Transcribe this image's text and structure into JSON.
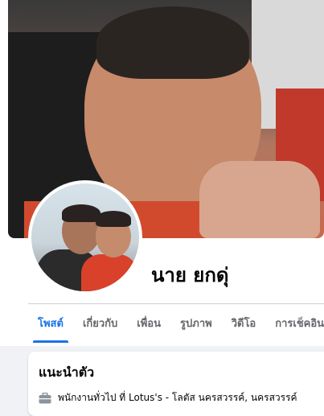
{
  "profile": {
    "name": "นาย ยกดุ่"
  },
  "tabs": [
    {
      "label": "โพสต์",
      "active": true
    },
    {
      "label": "เกี่ยวกับ",
      "active": false
    },
    {
      "label": "เพื่อน",
      "active": false
    },
    {
      "label": "รูปภาพ",
      "active": false
    },
    {
      "label": "วิดีโอ",
      "active": false
    },
    {
      "label": "การเช็คอิน",
      "active": false
    }
  ],
  "intro": {
    "title": "แนะนำตัว",
    "items": [
      {
        "icon": "briefcase-icon",
        "text": "พนักงานทั่วไป ที่ Lotus's - โลตัส นครสวรรค์, นครสวรรค์"
      }
    ]
  },
  "colors": {
    "accent": "#1b74e4",
    "text": "#050505",
    "secondary_text": "#65676b",
    "page_background": "#f0f2f5"
  }
}
